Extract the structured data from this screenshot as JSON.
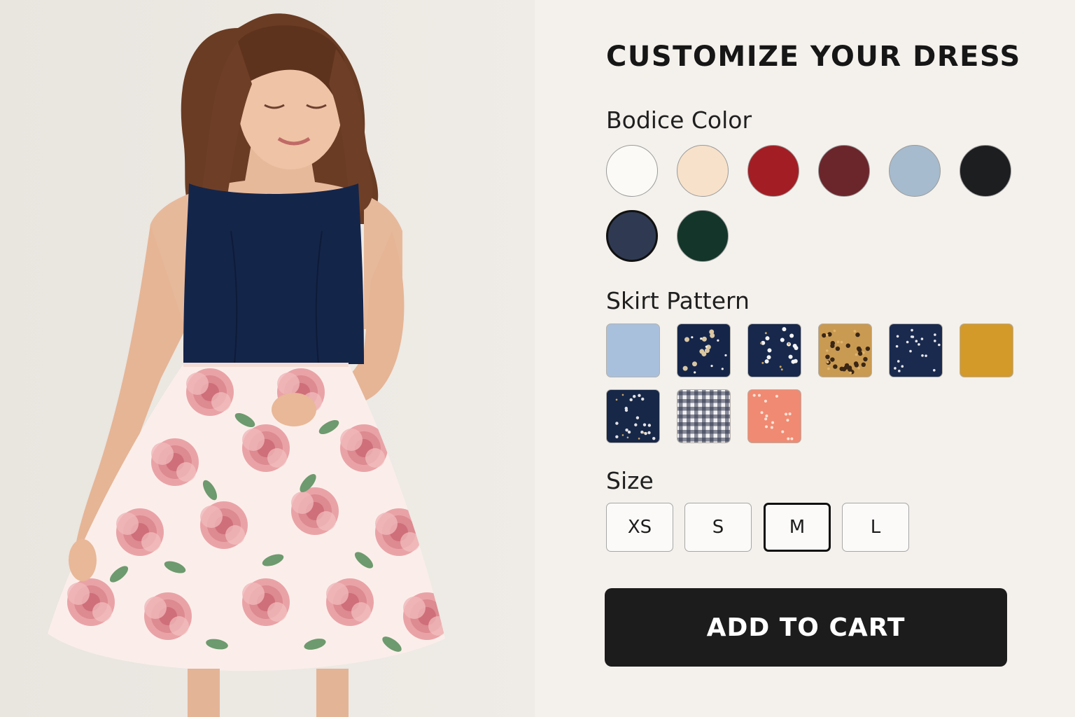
{
  "panel": {
    "title": "CUSTOMIZE YOUR DRESS",
    "bodice_label": "Bodice Color",
    "skirt_label": "Skirt Pattern",
    "size_label": "Size",
    "cart_button": "ADD TO CART"
  },
  "bodice_colors": [
    {
      "name": "ivory",
      "hex": "#fbfaf6"
    },
    {
      "name": "blush",
      "hex": "#f8e1ca"
    },
    {
      "name": "red",
      "hex": "#a31e24"
    },
    {
      "name": "burgundy",
      "hex": "#6b262c"
    },
    {
      "name": "light-blue",
      "hex": "#a6bbcd"
    },
    {
      "name": "black",
      "hex": "#1d1e20"
    },
    {
      "name": "navy",
      "hex": "#2f3a52",
      "selected": true
    },
    {
      "name": "forest-green",
      "hex": "#14352a"
    }
  ],
  "skirt_patterns": [
    {
      "name": "light-blue-solid",
      "base": "#a9c0dc"
    },
    {
      "name": "navy-gold-floral",
      "base": "#15254a"
    },
    {
      "name": "navy-white-floral",
      "base": "#17284c"
    },
    {
      "name": "leopard",
      "base": "#c99a52"
    },
    {
      "name": "navy-ditsy-floral",
      "base": "#1a2a4e"
    },
    {
      "name": "mustard-solid",
      "base": "#d39a2a"
    },
    {
      "name": "navy-small-floral",
      "base": "#172748"
    },
    {
      "name": "gingham",
      "base": "#f1f1f3"
    },
    {
      "name": "coral-floral",
      "base": "#f08a72"
    }
  ],
  "sizes": [
    {
      "label": "XS"
    },
    {
      "label": "S"
    },
    {
      "label": "M",
      "selected": true
    },
    {
      "label": "L"
    }
  ]
}
